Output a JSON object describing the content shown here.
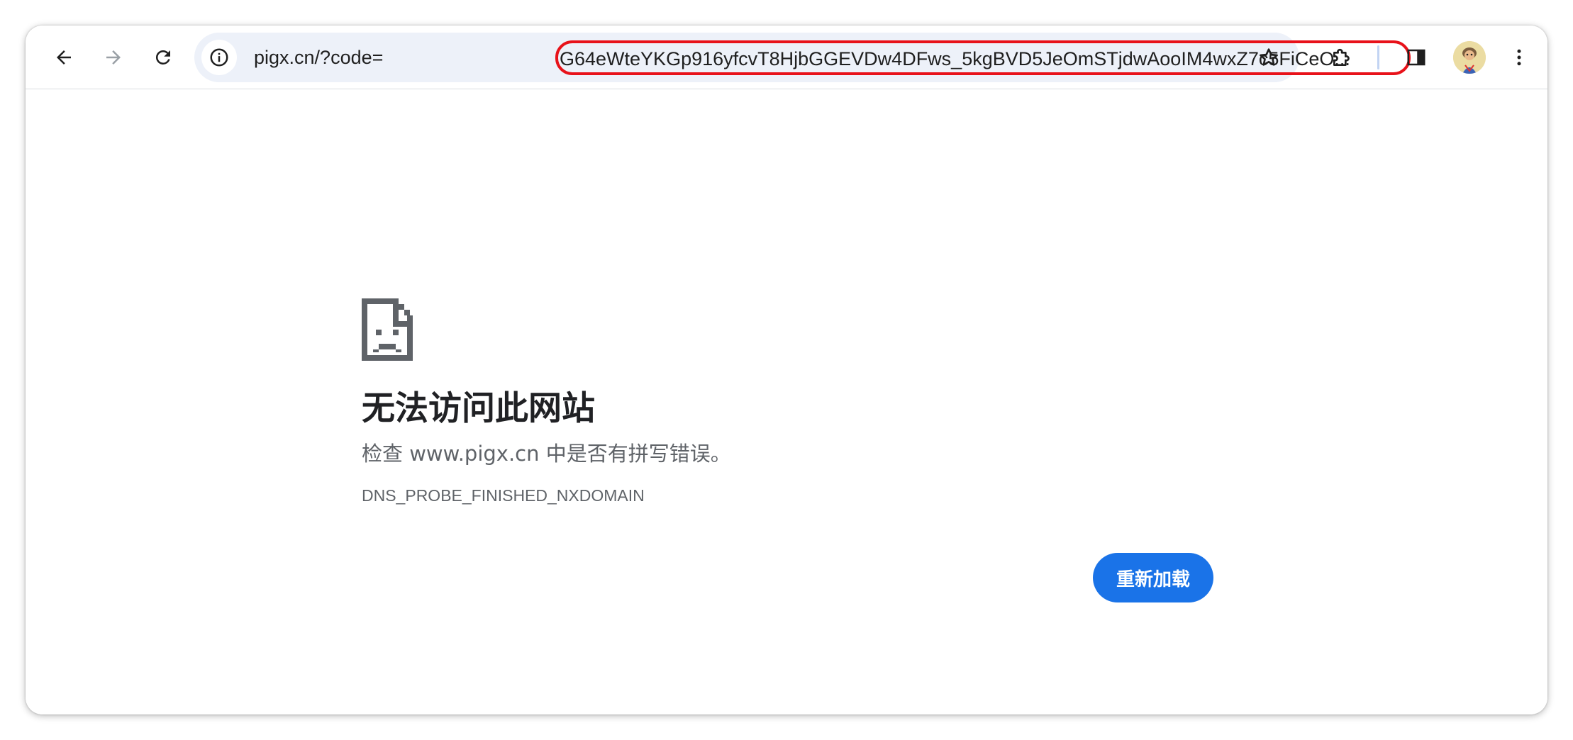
{
  "browser": {
    "url_prefix": "pigx.cn/?code=",
    "url_code": "G64eWteYKGp916yfcvT8HjbGGEVDw4DFws_5kgBVD5JeOmSTjdwAooIM4wxZ7c5FiCeO...",
    "icons": {
      "back": "arrow-left-icon",
      "forward": "arrow-right-icon",
      "reload": "reload-icon",
      "site_info": "info-icon",
      "bookmark": "star-icon",
      "extensions": "puzzle-icon",
      "side_panel": "side-panel-icon",
      "menu": "kebab-menu-icon"
    },
    "colors": {
      "omnibox_bg": "#edf1f9",
      "highlight": "#e8121a",
      "forward_disabled": "#9aa0a6"
    }
  },
  "error_page": {
    "title": "无法访问此网站",
    "description": "检查 www.pigx.cn 中是否有拼写错误。",
    "error_code": "DNS_PROBE_FINISHED_NXDOMAIN",
    "reload_label": "重新加载",
    "icon": "sad-page-icon",
    "accent": "#1a73e8"
  }
}
